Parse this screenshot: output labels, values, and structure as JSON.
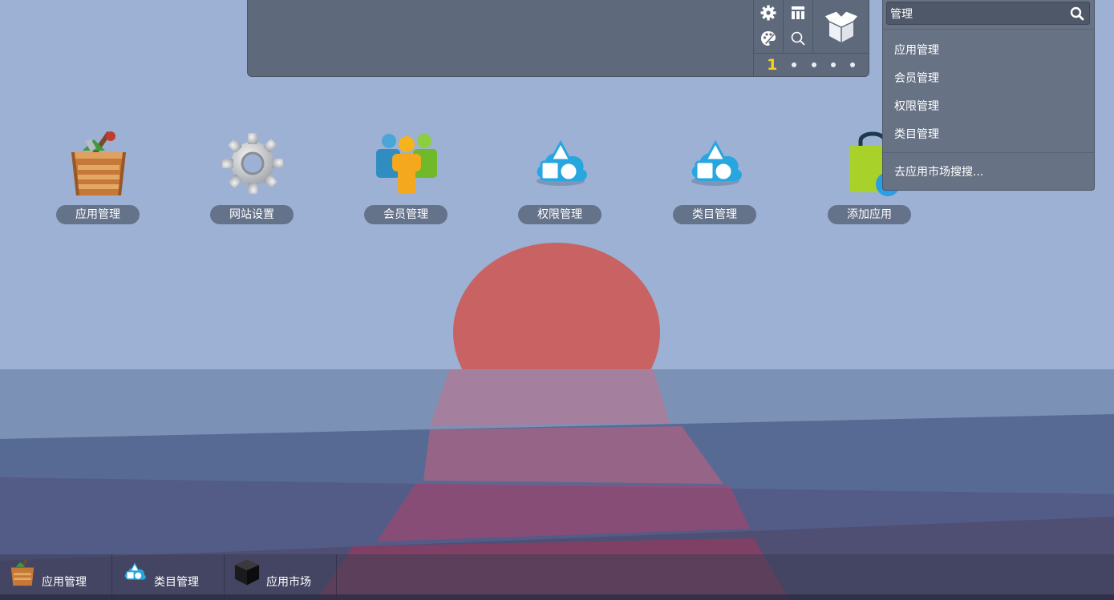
{
  "colors": {
    "sky": "#9cb1d3",
    "sun": "#c96363",
    "panel": "#5e6a7c",
    "page_indicator": "#f6d21b",
    "label_pill": "#64728a"
  },
  "toolbar": {
    "icons": [
      "gear-icon",
      "grid-icon",
      "palette-icon",
      "search-icon",
      "app-box-icon"
    ],
    "page_current": "1",
    "page_count": 5
  },
  "search": {
    "value": "管理",
    "results": [
      "应用管理",
      "会员管理",
      "权限管理",
      "类目管理"
    ],
    "market_link": "去应用市场搜搜..."
  },
  "desktop": {
    "icons": [
      {
        "label": "应用管理",
        "icon": "crate-tools-icon"
      },
      {
        "label": "网站设置",
        "icon": "gear-icon"
      },
      {
        "label": "会员管理",
        "icon": "users-icon"
      },
      {
        "label": "权限管理",
        "icon": "shapes-cloud-icon"
      },
      {
        "label": "类目管理",
        "icon": "shapes-cloud-icon"
      },
      {
        "label": "添加应用",
        "icon": "shopping-bag-add-icon"
      }
    ]
  },
  "taskbar": {
    "items": [
      {
        "label": "应用管理",
        "icon": "crate-tools-icon"
      },
      {
        "label": "类目管理",
        "icon": "shapes-cloud-icon"
      },
      {
        "label": "应用市场",
        "icon": "black-cube-icon"
      }
    ]
  }
}
